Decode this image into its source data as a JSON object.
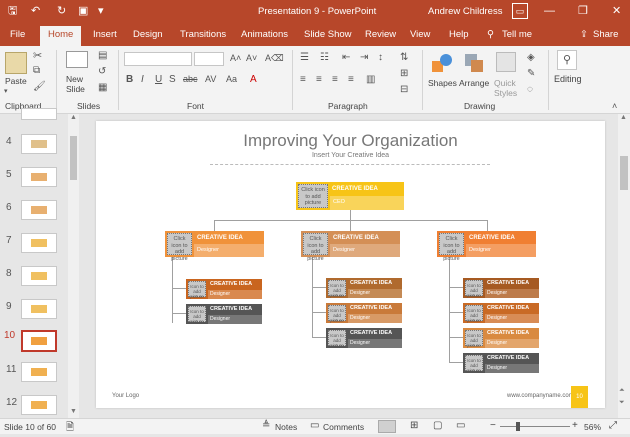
{
  "window": {
    "title": "Presentation 9  -  PowerPoint",
    "user": "Andrew Childress"
  },
  "tabs": [
    "File",
    "Home",
    "Insert",
    "Design",
    "Transitions",
    "Animations",
    "Slide Show",
    "Review",
    "View",
    "Help",
    "Tell me",
    "Share"
  ],
  "ribbon": {
    "clipboard": {
      "paste": "Paste",
      "label": "Clipboard"
    },
    "slides": {
      "new_slide": "New Slide",
      "label": "Slides"
    },
    "font": {
      "label": "Font"
    },
    "paragraph": {
      "label": "Paragraph"
    },
    "drawing": {
      "shapes": "Shapes",
      "arrange": "Arrange",
      "quick_styles": "Quick Styles",
      "label": "Drawing"
    },
    "editing": {
      "label": "Editing"
    }
  },
  "thumbnails": [
    {
      "num": "4"
    },
    {
      "num": "5"
    },
    {
      "num": "6"
    },
    {
      "num": "7"
    },
    {
      "num": "8"
    },
    {
      "num": "9"
    },
    {
      "num": "10"
    },
    {
      "num": "11"
    },
    {
      "num": "12"
    }
  ],
  "slide": {
    "title": "Improving Your Organization",
    "subtitle": "Insert Your Creative Idea",
    "logo": "Your Logo",
    "website": "www.companyname.com",
    "page_number": "10",
    "pic_placeholder": "Click icon to add picture",
    "pic_placeholder_small": "Icon to add picture",
    "top": {
      "title": "CREATIVE IDEA",
      "role": "CEO"
    },
    "mid": {
      "title": "CREATIVE IDEA",
      "role": "Designer"
    },
    "sub": {
      "title": "CREATIVE IDEA",
      "role": "Designer"
    }
  },
  "colors": {
    "accent": "#b7472a",
    "top": "#f7c417",
    "orange": "#f0923a",
    "brown": "#d48f56",
    "rust": "#c9651f",
    "gray": "#6f6f6f"
  },
  "status": {
    "slide": "Slide 10 of 60",
    "notes": "Notes",
    "comments": "Comments",
    "zoom": "56%"
  }
}
